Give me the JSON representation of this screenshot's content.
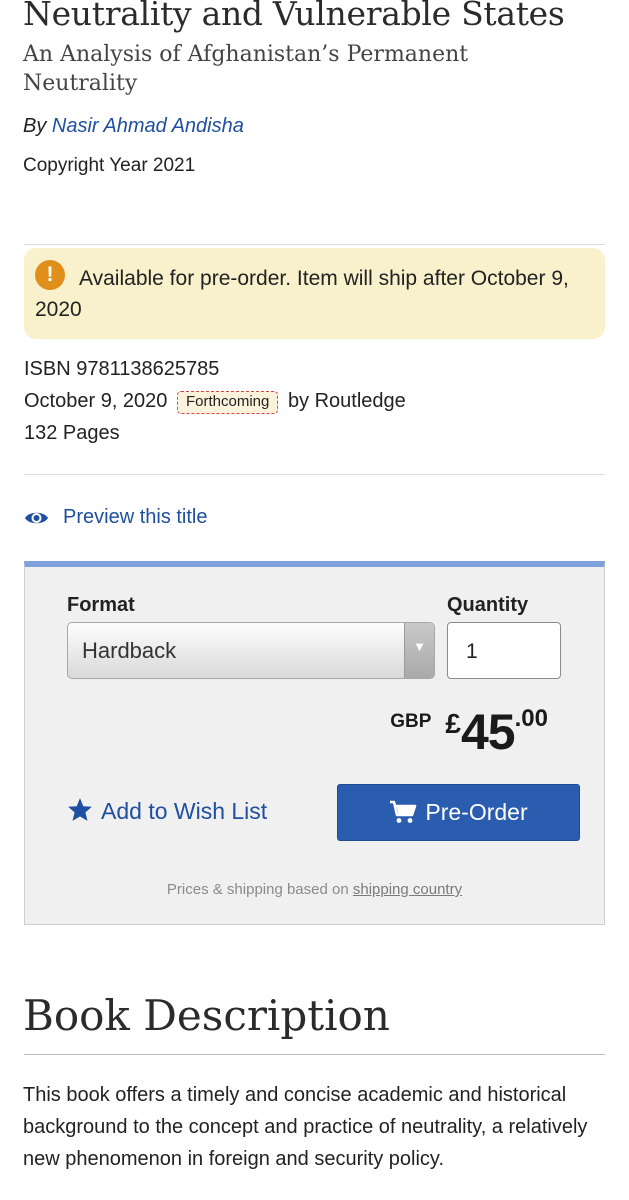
{
  "book": {
    "title": "Neutrality and Vulnerable States",
    "subtitle": "An Analysis of Afghanistan’s Permanent Neutrality",
    "by_prefix": "By",
    "author": "Nasir Ahmad Andisha",
    "copyright": "Copyright Year 2021"
  },
  "notice": {
    "icon": "!",
    "text": "Available for pre-order. Item will ship after October 9, 2020"
  },
  "details": {
    "isbn": "ISBN 9781138625785",
    "date": "October 9, 2020",
    "status_badge": "Forthcoming",
    "publisher": "by Routledge",
    "pages": "132 Pages"
  },
  "preview": {
    "label": "Preview this title"
  },
  "purchase": {
    "format_label": "Format",
    "format_value": "Hardback",
    "quantity_label": "Quantity",
    "quantity_value": "1",
    "currency_code": "GBP",
    "currency_symbol": "£",
    "price_whole": "45",
    "price_decimal": ".00",
    "wishlist_label": "Add to Wish List",
    "preorder_label": "Pre-Order",
    "shipping_note_prefix": "Prices & shipping based on",
    "shipping_link": "shipping country"
  },
  "description": {
    "heading": "Book Description",
    "text": "This book offers a timely and concise academic and historical background to the concept and practice of neutrality, a relatively new phenomenon in foreign and security policy."
  },
  "colors": {
    "link_blue": "#1f4fa0",
    "button_blue": "#2a5cb0",
    "notice_bg": "#f8f1cc",
    "warning_orange": "#e0901a",
    "panel_top_border": "#7ea1dc"
  }
}
